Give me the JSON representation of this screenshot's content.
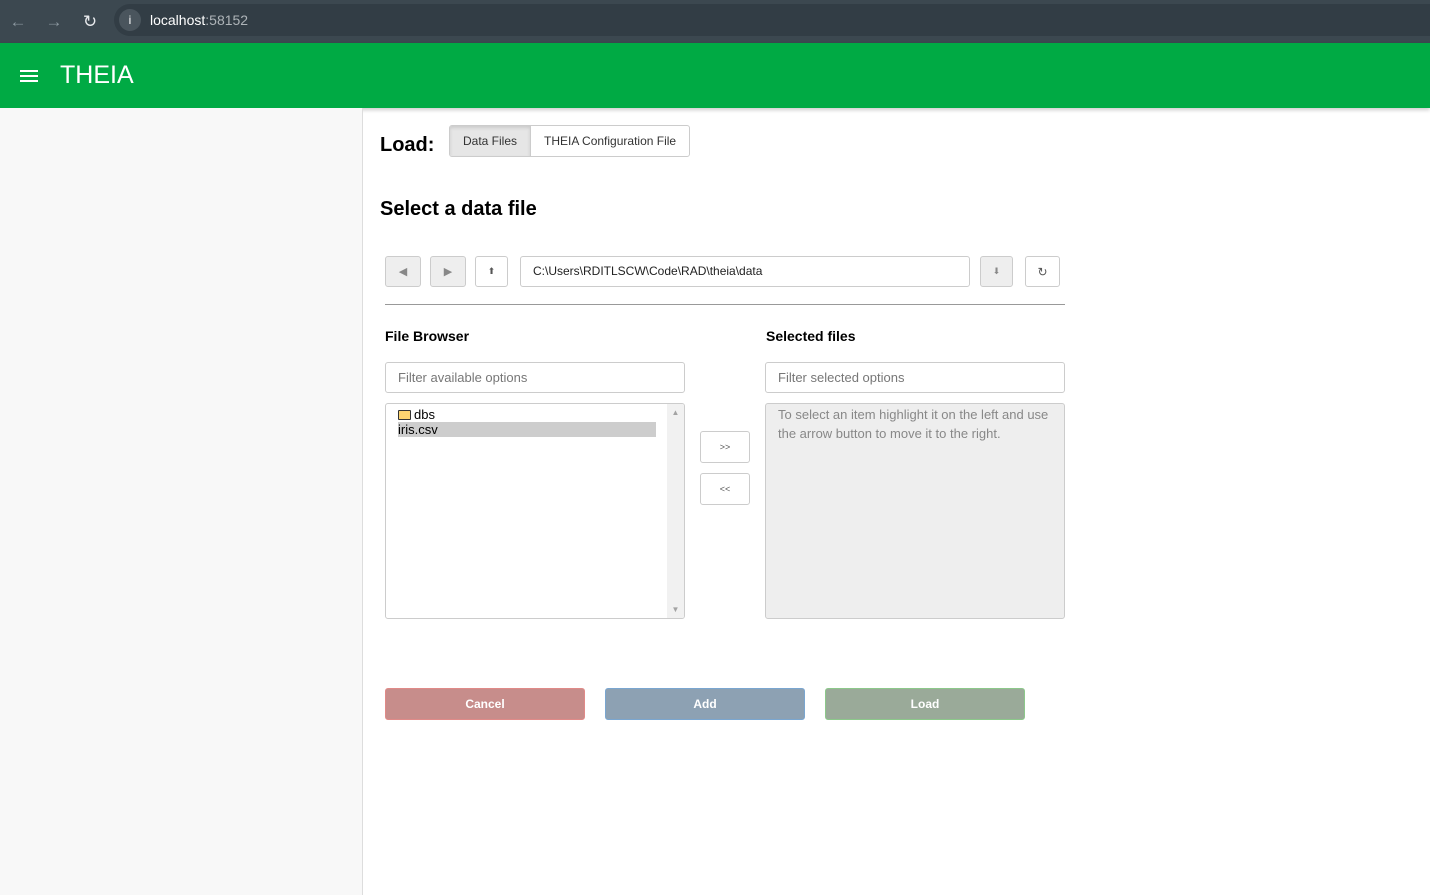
{
  "browser": {
    "host": "localhost",
    "port": ":58152"
  },
  "app": {
    "title": "THEIA"
  },
  "load": {
    "label": "Load:",
    "tabs": [
      {
        "label": "Data Files",
        "active": true
      },
      {
        "label": "THEIA Configuration File",
        "active": false
      }
    ]
  },
  "heading": "Select a data file",
  "toolbar": {
    "back": "◀",
    "forward": "▶",
    "up": "⬆",
    "path": "C:\\Users\\RDITLSCW\\Code\\RAD\\theia\\data",
    "down": "⬇",
    "refresh": "↻"
  },
  "browser_panel": {
    "title": "File Browser",
    "filter_placeholder": "Filter available options",
    "items": [
      {
        "label": "dbs",
        "type": "folder",
        "selected": false
      },
      {
        "label": "iris.csv",
        "type": "file",
        "selected": true
      }
    ]
  },
  "selected_panel": {
    "title": "Selected files",
    "filter_placeholder": "Filter selected options",
    "hint": "To select an item highlight it on the left and use the arrow button to move it to the right."
  },
  "move": {
    "right": ">>",
    "left": "<<"
  },
  "actions": {
    "cancel": "Cancel",
    "add": "Add",
    "load": "Load"
  },
  "colors": {
    "brand": "#00aa44",
    "cancel": "#c78d8b",
    "add": "#8da1b3",
    "load": "#9aaa99"
  }
}
